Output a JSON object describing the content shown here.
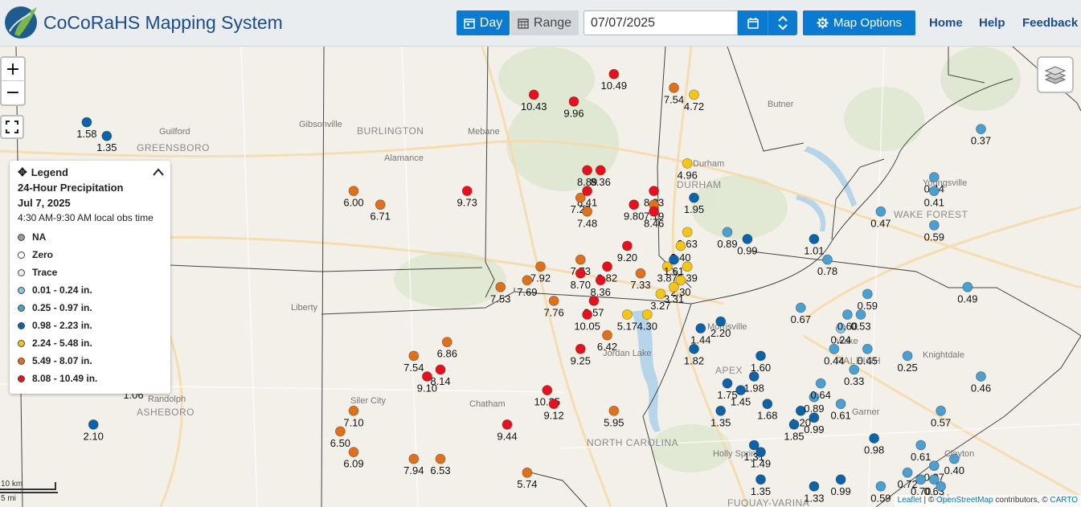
{
  "header": {
    "app_title": "CoCoRaHS Mapping System",
    "day_label": "Day",
    "range_label": "Range",
    "date_value": "07/07/2025",
    "map_options_label": "Map Options",
    "nav": [
      "Home",
      "Help",
      "Feedback"
    ]
  },
  "legend": {
    "header": "Legend",
    "title": "24-Hour Precipitation",
    "date": "Jul 7, 2025",
    "time": "4:30 AM-9:30 AM local obs time",
    "items": [
      {
        "label": "NA",
        "color": "#9a9a9a"
      },
      {
        "label": "Zero",
        "color": "#ffffff"
      },
      {
        "label": "Trace",
        "color": "#e6eef6"
      },
      {
        "label": "0.01 - 0.24 in.",
        "color": "#8cc2e6"
      },
      {
        "label": "0.25 - 0.97 in.",
        "color": "#4b9fd1"
      },
      {
        "label": "0.98 - 2.23 in.",
        "color": "#0d63a8"
      },
      {
        "label": "2.24 - 5.48 in.",
        "color": "#f5c518"
      },
      {
        "label": "5.49 - 8.07 in.",
        "color": "#e0701c"
      },
      {
        "label": "8.08 - 10.49 in.",
        "color": "#e8101c"
      }
    ]
  },
  "map": {
    "places": [
      "Guilford",
      "GREENSBORO",
      "BURLINGTON",
      "Alamance",
      "Gibsonville",
      "Mebane",
      "Butner",
      "Durham",
      "DURHAM",
      "Youngsville",
      "WAKE FOREST",
      "Liberty",
      "Randolph",
      "ASHEBORO",
      "Siler City",
      "Chatham",
      "NORTH CAROLINA",
      "Morrisville",
      "Jordan Lake",
      "APEX",
      "Holly Springs",
      "FUQUAY-VARINA",
      "Garner",
      "Knightdale",
      "Clayton",
      "RALEIGH",
      "Wake"
    ],
    "stations": [
      {
        "v": "10.49",
        "lng": -79.06,
        "lat": 36.19
      },
      {
        "v": "10.43",
        "lng": -79.18,
        "lat": 36.16
      },
      {
        "v": "9.96",
        "lng": -79.12,
        "lat": 36.15
      },
      {
        "v": "7.54",
        "lng": -78.97,
        "lat": 36.17
      },
      {
        "v": "4.72",
        "lng": -78.94,
        "lat": 36.16
      },
      {
        "v": "4.96",
        "lng": -78.95,
        "lat": 36.06
      },
      {
        "v": "8.89",
        "lng": -79.1,
        "lat": 36.05
      },
      {
        "v": "8.36",
        "lng": -79.08,
        "lat": 36.05
      },
      {
        "v": "8.41",
        "lng": -79.1,
        "lat": 36.02
      },
      {
        "v": "8.23",
        "lng": -79.0,
        "lat": 36.02
      },
      {
        "v": "7.19",
        "lng": -79.0,
        "lat": 36.0
      },
      {
        "v": "1.95",
        "lng": -78.94,
        "lat": 36.01
      },
      {
        "v": "7.27",
        "lng": -79.11,
        "lat": 36.01
      },
      {
        "v": "7.48",
        "lng": -79.1,
        "lat": 35.99
      },
      {
        "v": "9.80",
        "lng": -79.03,
        "lat": 36.0
      },
      {
        "v": "8.46",
        "lng": -79.0,
        "lat": 35.99
      },
      {
        "v": "9.73",
        "lng": -79.28,
        "lat": 36.02
      },
      {
        "v": "6.00",
        "lng": -79.45,
        "lat": 36.02
      },
      {
        "v": "6.71",
        "lng": -79.41,
        "lat": 36.0
      },
      {
        "v": "2.63",
        "lng": -78.95,
        "lat": 35.96
      },
      {
        "v": "0.89",
        "lng": -78.89,
        "lat": 35.96
      },
      {
        "v": "0.99",
        "lng": -78.86,
        "lat": 35.95
      },
      {
        "v": "9.20",
        "lng": -79.04,
        "lat": 35.94
      },
      {
        "v": "2.40",
        "lng": -78.96,
        "lat": 35.94
      },
      {
        "v": "7.73",
        "lng": -79.11,
        "lat": 35.92
      },
      {
        "v": "7.92",
        "lng": -79.17,
        "lat": 35.91
      },
      {
        "v": "3.87",
        "lng": -78.98,
        "lat": 35.91
      },
      {
        "v": "1.61",
        "lng": -78.97,
        "lat": 35.92
      },
      {
        "v": "2.39",
        "lng": -78.95,
        "lat": 35.91
      },
      {
        "v": "9.82",
        "lng": -79.07,
        "lat": 35.91
      },
      {
        "v": "7.69",
        "lng": -79.19,
        "lat": 35.89
      },
      {
        "v": "8.70",
        "lng": -79.11,
        "lat": 35.9
      },
      {
        "v": "8.36",
        "lng": -79.08,
        "lat": 35.89
      },
      {
        "v": "7.33",
        "lng": -79.02,
        "lat": 35.9
      },
      {
        "v": "2.30",
        "lng": -78.96,
        "lat": 35.89
      },
      {
        "v": "7.53",
        "lng": -79.23,
        "lat": 35.88
      },
      {
        "v": "3.31",
        "lng": -78.97,
        "lat": 35.88
      },
      {
        "v": "3.27",
        "lng": -78.99,
        "lat": 35.87
      },
      {
        "v": "7.76",
        "lng": -79.15,
        "lat": 35.86
      },
      {
        "v": "9.57",
        "lng": -79.09,
        "lat": 35.86
      },
      {
        "v": "10.05",
        "lng": -79.1,
        "lat": 35.84
      },
      {
        "v": "5.17",
        "lng": -79.04,
        "lat": 35.84
      },
      {
        "v": "4.30",
        "lng": -79.01,
        "lat": 35.84
      },
      {
        "v": "2.20",
        "lng": -78.9,
        "lat": 35.83
      },
      {
        "v": "1.44",
        "lng": -78.93,
        "lat": 35.82
      },
      {
        "v": "6.42",
        "lng": -79.07,
        "lat": 35.81
      },
      {
        "v": "1.82",
        "lng": -78.94,
        "lat": 35.79
      },
      {
        "v": "9.25",
        "lng": -79.11,
        "lat": 35.79
      },
      {
        "v": "6.86",
        "lng": -79.31,
        "lat": 35.8
      },
      {
        "v": "7.54",
        "lng": -79.36,
        "lat": 35.78
      },
      {
        "v": "8.14",
        "lng": -79.32,
        "lat": 35.76
      },
      {
        "v": "9.10",
        "lng": -79.34,
        "lat": 35.75
      },
      {
        "v": "10.35",
        "lng": -79.16,
        "lat": 35.73
      },
      {
        "v": "9.12",
        "lng": -79.15,
        "lat": 35.71
      },
      {
        "v": "5.95",
        "lng": -79.06,
        "lat": 35.7
      },
      {
        "v": "9.44",
        "lng": -79.22,
        "lat": 35.68
      },
      {
        "v": "7.10",
        "lng": -79.45,
        "lat": 35.7
      },
      {
        "v": "6.50",
        "lng": -79.47,
        "lat": 35.67
      },
      {
        "v": "6.09",
        "lng": -79.45,
        "lat": 35.64
      },
      {
        "v": "7.94",
        "lng": -79.36,
        "lat": 35.63
      },
      {
        "v": "6.53",
        "lng": -79.32,
        "lat": 35.63
      },
      {
        "v": "5.74",
        "lng": -79.19,
        "lat": 35.61
      },
      {
        "v": "1.58",
        "lng": -79.85,
        "lat": 36.12
      },
      {
        "v": "1.35",
        "lng": -79.82,
        "lat": 36.1
      },
      {
        "v": "2.10",
        "lng": -79.84,
        "lat": 35.68
      },
      {
        "v": "1.06",
        "lng": -79.78,
        "lat": 35.74
      },
      {
        "v": "1.75",
        "lng": -78.89,
        "lat": 35.74
      },
      {
        "v": "1.45",
        "lng": -78.87,
        "lat": 35.73
      },
      {
        "v": "1.60",
        "lng": -78.84,
        "lat": 35.78
      },
      {
        "v": "1.98",
        "lng": -78.85,
        "lat": 35.75
      },
      {
        "v": "1.68",
        "lng": -78.83,
        "lat": 35.71
      },
      {
        "v": "1.35",
        "lng": -78.9,
        "lat": 35.7
      },
      {
        "v": "1.31",
        "lng": -78.85,
        "lat": 35.65
      },
      {
        "v": "1.49",
        "lng": -78.84,
        "lat": 35.64
      },
      {
        "v": "1.35",
        "lng": -78.84,
        "lat": 35.6
      },
      {
        "v": "1.33",
        "lng": -78.76,
        "lat": 35.59
      },
      {
        "v": "0.99",
        "lng": -78.72,
        "lat": 35.6
      },
      {
        "v": "1.20",
        "lng": -78.78,
        "lat": 35.7
      },
      {
        "v": "1.85",
        "lng": -78.79,
        "lat": 35.68
      },
      {
        "v": "0.99",
        "lng": -78.76,
        "lat": 35.69
      },
      {
        "v": "0.89",
        "lng": -78.76,
        "lat": 35.72
      },
      {
        "v": "0.64",
        "lng": -78.75,
        "lat": 35.74
      },
      {
        "v": "0.61",
        "lng": -78.72,
        "lat": 35.71
      },
      {
        "v": "0.98",
        "lng": -78.67,
        "lat": 35.66
      },
      {
        "v": "0.61",
        "lng": -78.6,
        "lat": 35.65
      },
      {
        "v": "0.57",
        "lng": -78.57,
        "lat": 35.7
      },
      {
        "v": "0.46",
        "lng": -78.51,
        "lat": 35.75
      },
      {
        "v": "0.25",
        "lng": -78.62,
        "lat": 35.78
      },
      {
        "v": "0.45",
        "lng": -78.68,
        "lat": 35.79
      },
      {
        "v": "0.33",
        "lng": -78.7,
        "lat": 35.76
      },
      {
        "v": "0.44",
        "lng": -78.73,
        "lat": 35.79
      },
      {
        "v": "0.24",
        "lng": -78.72,
        "lat": 35.82
      },
      {
        "v": "0.53",
        "lng": -78.69,
        "lat": 35.84
      },
      {
        "v": "0.60",
        "lng": -78.71,
        "lat": 35.84
      },
      {
        "v": "0.67",
        "lng": -78.78,
        "lat": 35.85
      },
      {
        "v": "0.59",
        "lng": -78.68,
        "lat": 35.87
      },
      {
        "v": "0.49",
        "lng": -78.53,
        "lat": 35.88
      },
      {
        "v": "0.78",
        "lng": -78.74,
        "lat": 35.92
      },
      {
        "v": "1.01",
        "lng": -78.76,
        "lat": 35.95
      },
      {
        "v": "0.47",
        "lng": -78.66,
        "lat": 35.99
      },
      {
        "v": "0.59",
        "lng": -78.58,
        "lat": 35.97
      },
      {
        "v": "0.44",
        "lng": -78.58,
        "lat": 36.04
      },
      {
        "v": "0.41",
        "lng": -78.58,
        "lat": 36.02
      },
      {
        "v": "0.37",
        "lng": -78.51,
        "lat": 36.11
      },
      {
        "v": "0.40",
        "lng": -78.55,
        "lat": 35.63
      },
      {
        "v": "0.37",
        "lng": -78.58,
        "lat": 35.62
      },
      {
        "v": "0.72",
        "lng": -78.62,
        "lat": 35.61
      },
      {
        "v": "0.70",
        "lng": -78.6,
        "lat": 35.6
      },
      {
        "v": "0.63",
        "lng": -78.58,
        "lat": 35.6
      },
      {
        "v": "0.61",
        "lng": -78.57,
        "lat": 35.59
      },
      {
        "v": "0.59",
        "lng": -78.66,
        "lat": 35.59
      }
    ]
  },
  "scale": {
    "km": "10 km",
    "mi": "5 mi"
  },
  "attribution": {
    "leaflet": "Leaflet",
    "sep1": " | © ",
    "osm": "OpenStreetMap",
    "mid": " contributors, © ",
    "carto": "CARTO"
  }
}
